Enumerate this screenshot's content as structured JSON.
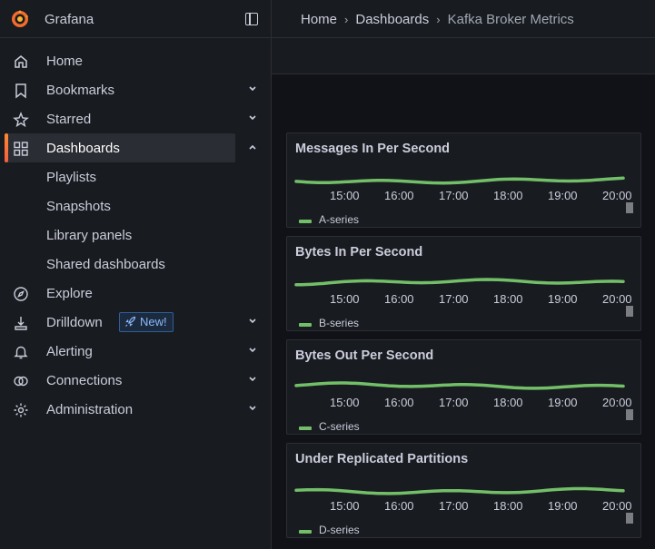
{
  "app": {
    "name": "Grafana"
  },
  "breadcrumb": {
    "home": "Home",
    "dashboards": "Dashboards",
    "current": "Kafka Broker Metrics"
  },
  "sidebar": {
    "items": [
      {
        "label": "Home",
        "icon": "home-icon"
      },
      {
        "label": "Bookmarks",
        "icon": "bookmark-icon"
      },
      {
        "label": "Starred",
        "icon": "star-icon"
      },
      {
        "label": "Dashboards",
        "icon": "dashboards-icon",
        "active": true
      },
      {
        "label": "Playlists"
      },
      {
        "label": "Snapshots"
      },
      {
        "label": "Library panels"
      },
      {
        "label": "Shared dashboards"
      },
      {
        "label": "Explore",
        "icon": "compass-icon"
      },
      {
        "label": "Drilldown",
        "icon": "drilldown-icon",
        "badge": "New!"
      },
      {
        "label": "Alerting",
        "icon": "bell-icon"
      },
      {
        "label": "Connections",
        "icon": "connections-icon"
      },
      {
        "label": "Administration",
        "icon": "gear-icon"
      }
    ]
  },
  "colors": {
    "series": "#73bf69",
    "accent": "#f55f3e",
    "badge": "#8ab8ff"
  },
  "time_ticks": [
    "15:00",
    "16:00",
    "17:00",
    "18:00",
    "19:00",
    "20:00"
  ],
  "panels": [
    {
      "title": "Messages In Per Second",
      "legend": "A-series"
    },
    {
      "title": "Bytes In Per Second",
      "legend": "B-series"
    },
    {
      "title": "Bytes Out Per Second",
      "legend": "C-series"
    },
    {
      "title": "Under Replicated Partitions",
      "legend": "D-series"
    }
  ]
}
